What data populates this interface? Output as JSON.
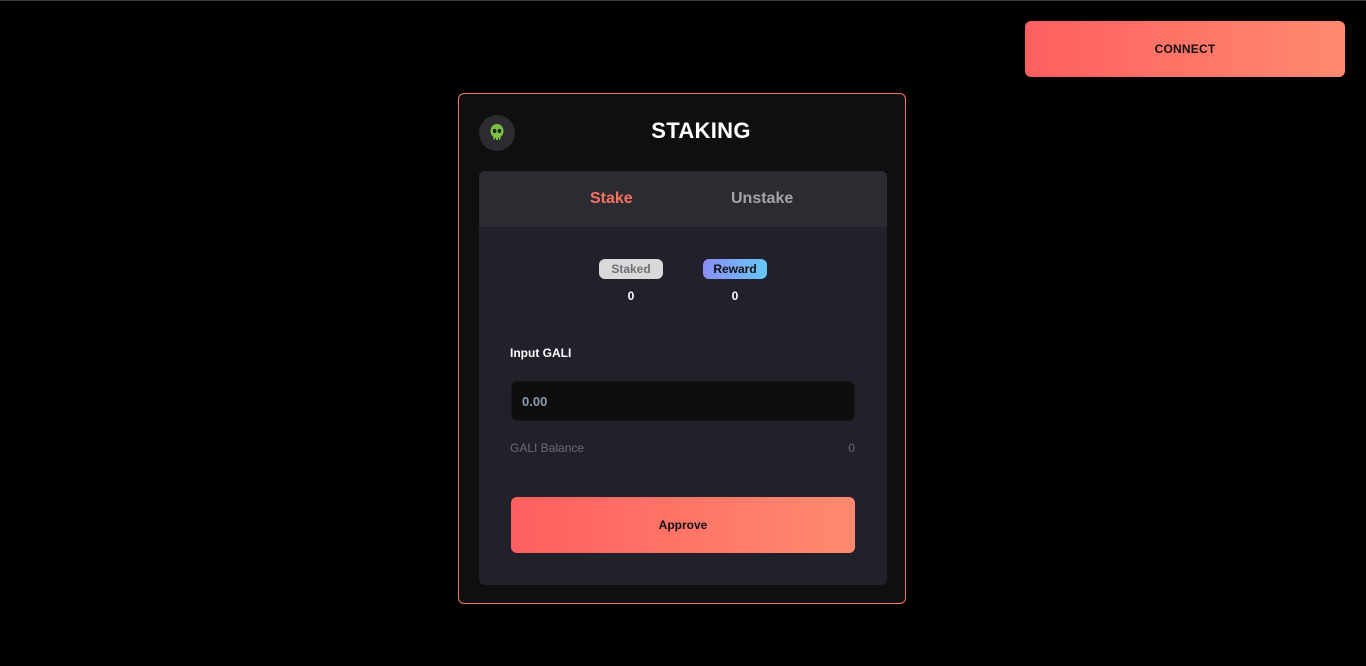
{
  "header": {
    "connect_label": "CONNECT"
  },
  "card": {
    "title": "STAKING",
    "avatar_icon": "skull-icon",
    "tabs": [
      {
        "label": "Stake",
        "active": true
      },
      {
        "label": "Unstake",
        "active": false
      }
    ],
    "stats": {
      "staked_label": "Staked",
      "staked_value": "0",
      "reward_label": "Reward",
      "reward_value": "0"
    },
    "input": {
      "label": "Input GALI",
      "placeholder": "0.00",
      "value": ""
    },
    "balance": {
      "label": "GALI Balance",
      "value": "0"
    },
    "approve_label": "Approve"
  },
  "colors": {
    "accent": "#f87162",
    "border": "#f4785c",
    "gradient_start": "#ff5f5f",
    "gradient_end": "#ff8a70"
  }
}
